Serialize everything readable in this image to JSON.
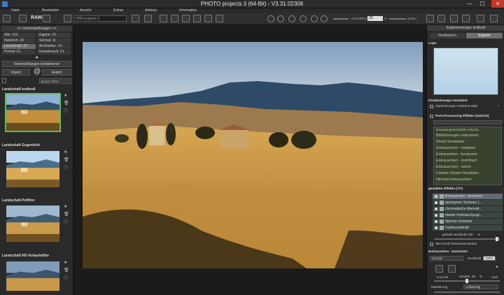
{
  "titlebar": {
    "title": "PHOTO projects 3 (64-Bit) - V3.31.02308",
    "minimize": "—",
    "maximize": "☐",
    "close": "✕"
  },
  "menu": [
    "Datei",
    "Bearbeiten",
    "Ansicht",
    "Extras",
    "Addons",
    "Information"
  ],
  "toolbar": {
    "raw": "RAW",
    "project": "HDR projects 3",
    "zoom_label": "Zoomfaktor",
    "zoom_value": "29",
    "zoom_unit": "%",
    "zoom_max": "größer"
  },
  "left": {
    "header": ">> Voreinstellungen <<",
    "categories": [
      [
        "Alle: 122",
        "Eigene: 10"
      ],
      [
        "Natürlich: 20",
        "Surreal: 11"
      ],
      [
        "Landschaft: 20",
        "Architektur: 13"
      ],
      [
        "Porträt: 21",
        "Künstlerisch: 21"
      ]
    ],
    "combine_btn": "Voreinstellungen kombinieren",
    "import_btn": "Import",
    "export_btn": "Export",
    "filter": "keinen Filter -",
    "presets": [
      "Landschaft kraftvoll",
      "Landschaft Gegenlicht",
      "Landschaft Polfilter",
      "Landschaft ND-Verlaufsfilter"
    ]
  },
  "right": {
    "header": "Expertenmodus: kraftvoll",
    "tabs": [
      "Finalisieren",
      "Experte"
    ],
    "loupe": "Lupe",
    "finalize_title": "Finalisierungs-Assistent",
    "optimize_label": "Optimierungs-Assistent aktiv",
    "pp_title": "Post-Processing Effekte (110/110)",
    "pp_items": [
      "Bewegungsunschärfe reduzier...",
      "Bildstörungen reduzieren",
      "Detail-Verstärker",
      "Entrauschen - Hotpixel",
      "Entrauschen - konturiert",
      "Entrauschen - mehrfach",
      "Entrauschen - weich",
      "Farbton Detail-Verstärker",
      "Himmel entrauschen"
    ],
    "fx_title": "gewählte Effekte (7/7)",
    "fx_items": [
      "Entrauschen - konturiert",
      "gezeigener Schwarz (...",
      "chromatische Aberrati...",
      "idealer Kontrast Ausgl...",
      "Weicher Kontrast",
      "Farbleuchtkraft"
    ],
    "global_label": "globale Deckkraft",
    "global_value": "100",
    "global_unit": "%",
    "panorama": "360-Grad Panorama Modus",
    "effect_title": "Entrauschen - konturiert",
    "blend_mode": "Normal",
    "opacity_label": "Deckkraft",
    "opacity_value": "100%",
    "sharp_label": "Schärfe",
    "sharp_value": "50",
    "sharp_unit": "%",
    "soft": "unscharf",
    "hard": "stark",
    "mask_label": "Maskierung",
    "mask_value": "vollständig"
  }
}
